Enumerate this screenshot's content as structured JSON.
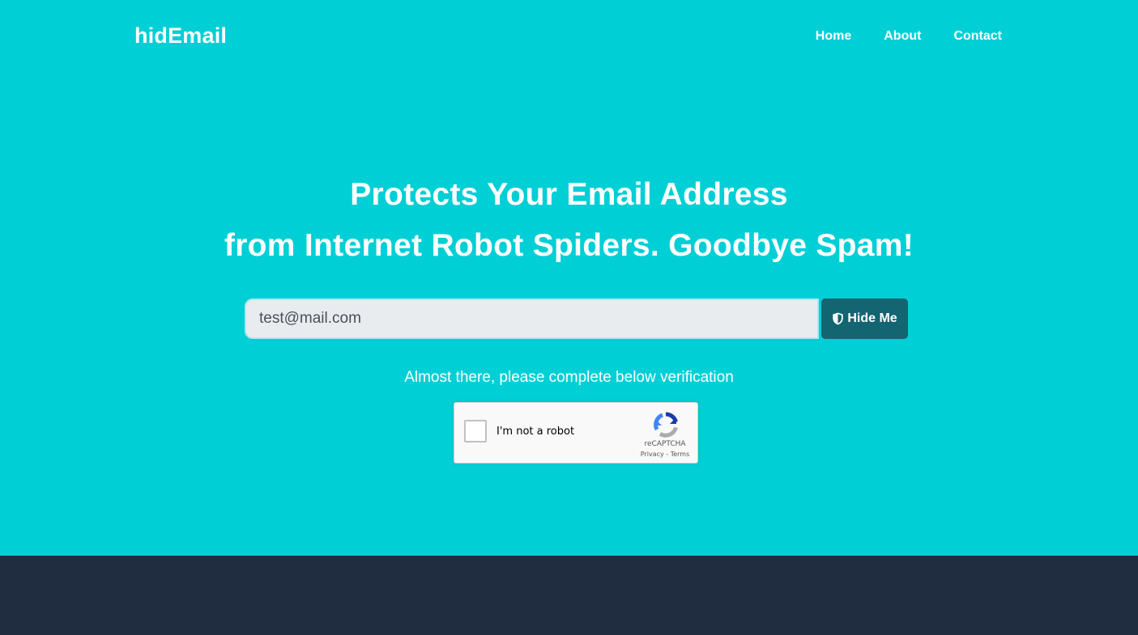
{
  "brand": {
    "name": "hidEmail"
  },
  "nav": {
    "items": [
      "Home",
      "About",
      "Contact"
    ]
  },
  "hero": {
    "headline_line1": "Protects Your Email Address",
    "headline_line2": "from Internet Robot Spiders. Goodbye Spam!",
    "email_value": "test@mail.com",
    "hide_button_label": "Hide Me",
    "hide_button_icon": "shield-icon",
    "verify_text": "Almost there, please complete below verification"
  },
  "captcha": {
    "label": "I'm not a robot",
    "brand": "reCAPTCHA",
    "privacy_label": "Privacy",
    "separator": "-",
    "terms_label": "Terms",
    "checked": false
  },
  "colors": {
    "hero_bg": "#01cfd6",
    "footer_bg": "#202c40",
    "button_bg": "#136571",
    "input_bg": "#e9ecef"
  }
}
